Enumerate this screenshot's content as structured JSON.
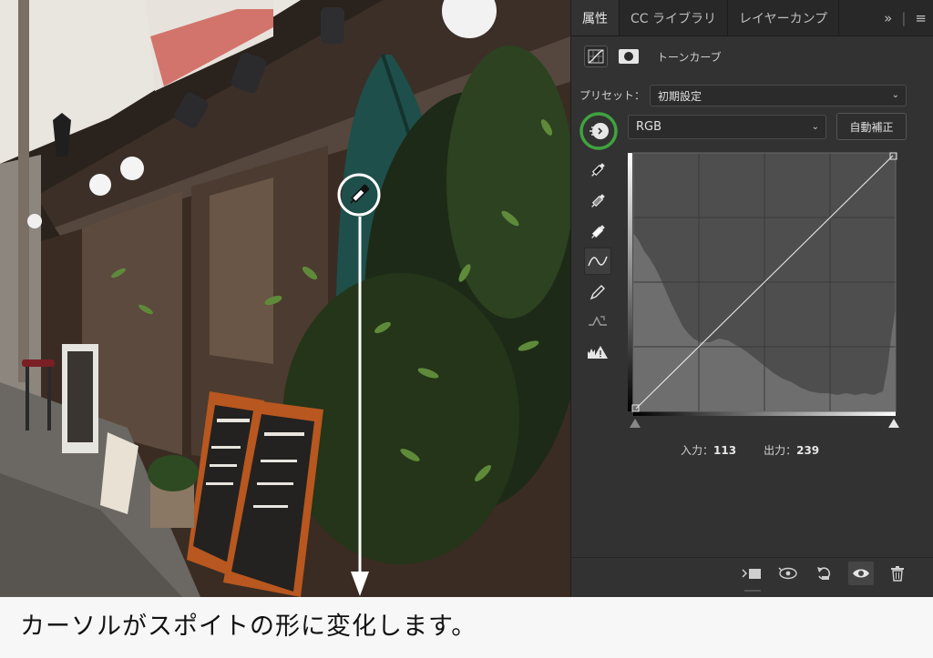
{
  "tabs": [
    {
      "label": "属性",
      "active": true
    },
    {
      "label": "CC ライブラリ",
      "active": false
    },
    {
      "label": "レイヤーカンプ",
      "active": false
    }
  ],
  "tab_menu": {
    "expand_icon": "double-chevron-right-icon",
    "menu_icon": "hamburger-menu-icon"
  },
  "panel": {
    "title": "トーンカーブ",
    "preset_label": "プリセット：",
    "preset_value": "初期設定",
    "channel_value": "RGB",
    "auto_button": "自動補正",
    "input_label": "入力：",
    "input_value": "113",
    "output_label": "出力：",
    "output_value": "239"
  },
  "tools": [
    "target-adjust-icon",
    "black-point-eyedropper-icon",
    "gray-point-eyedropper-icon",
    "white-point-eyedropper-icon",
    "curve-point-icon",
    "pencil-icon",
    "smooth-icon",
    "clipping-warning-icon"
  ],
  "bottom_icons": [
    "clip-to-layer-icon",
    "view-previous-state-icon",
    "reset-icon",
    "visibility-eye-icon",
    "trash-icon"
  ],
  "caption": "カーソルがスポイトの形に変化します。",
  "colors": {
    "panel_bg": "#323232",
    "tabbar_bg": "#282828",
    "highlight_ring": "#3fa33f",
    "annotation": "#ffffff"
  }
}
